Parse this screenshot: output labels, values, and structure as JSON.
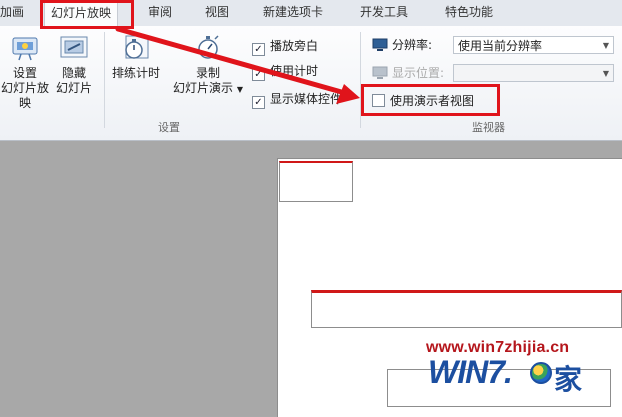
{
  "tabs": [
    "加画",
    "幻灯片放映",
    "审阅",
    "视图",
    "新建选项卡",
    "开发工具",
    "特色功能"
  ],
  "ribbon": {
    "start_group": {
      "setup_show": [
        "设置",
        "幻灯片放映"
      ],
      "hide_slide": [
        "隐藏",
        "幻灯片"
      ],
      "rehearse": "排练计时",
      "record": [
        "录制",
        "幻灯片演示"
      ],
      "checks": [
        {
          "label": "播放旁白",
          "checked": true
        },
        {
          "label": "使用计时",
          "checked": true
        },
        {
          "label": "显示媒体控件",
          "checked": true
        }
      ],
      "label": "设置"
    },
    "monitors": {
      "resolution_label": "分辨率:",
      "resolution_value": "使用当前分辨率",
      "show_on_label": "显示位置:",
      "show_on_value": "",
      "presenter_view": {
        "label": "使用演示者视图",
        "checked": false
      },
      "label": "监视器"
    }
  },
  "watermark": "www.win7zhijia.cn",
  "logo": {
    "text": "WIN7.",
    "cn": "家"
  },
  "colors": {
    "highlight": "#e0141b",
    "tab_bg": "#e4e8ee",
    "workspace": "#a8a8a8"
  }
}
